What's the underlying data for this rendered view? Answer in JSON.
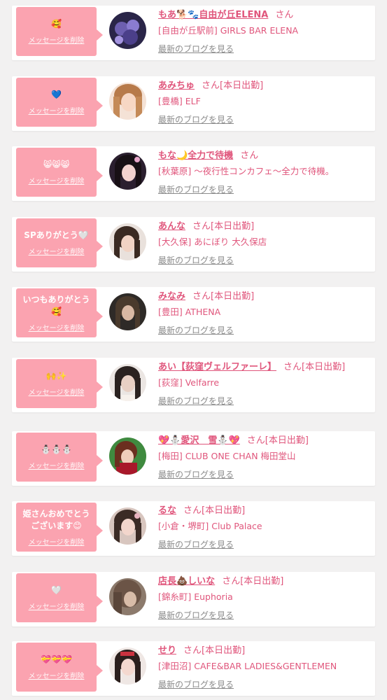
{
  "delete_label": "メッセージを削除",
  "blog_label": "最新のブログを見る",
  "items": [
    {
      "message": "🥰",
      "name": "もあ🐕🐾自由が丘ELENA",
      "suffix": "さん",
      "shop": "[自由が丘駅前] GIRLS BAR ELENA"
    },
    {
      "message": "💙",
      "name": "あみちゅ",
      "suffix": "さん[本日出勤]",
      "shop": "[豊橋] ELF"
    },
    {
      "message": "😸😸😸",
      "name": "もな🌙全力で待機",
      "suffix": "さん",
      "shop": "[秋葉原] 〜夜行性コンカフェ〜全力で待機。"
    },
    {
      "message": "SPありがとう🤍",
      "name": "あんな",
      "suffix": "さん[本日出勤]",
      "shop": "[大久保] あにぼり 大久保店"
    },
    {
      "message": "いつもありがとう\n🥰",
      "name": "みなみ",
      "suffix": "さん[本日出勤]",
      "shop": "[豊田] ATHENA"
    },
    {
      "message": "🙌✨",
      "name": "あい【荻窪ヴェルファーレ】",
      "suffix": "さん[本日出勤]",
      "shop": "[荻窪] Velfarre"
    },
    {
      "message": "⛄⛄⛄",
      "name": "💖⛄愛沢　雪⛄💖",
      "suffix": "さん[本日出勤]",
      "shop": "[梅田] CLUB ONE CHAN 梅田堂山"
    },
    {
      "message": "姫さんおめでとう\nございます😊",
      "name": "るな",
      "suffix": "さん[本日出勤]",
      "shop": "[小倉・堺町] Club Palace"
    },
    {
      "message": "🤍",
      "name": "店長💩しいな",
      "suffix": "さん[本日出勤]",
      "shop": "[錦糸町] Euphoria"
    },
    {
      "message": "💝💝💝",
      "name": "せり",
      "suffix": "さん[本日出勤]",
      "shop": "[津田沼] CAFE&BAR LADIES&GENTLEMEN"
    }
  ],
  "colors": {
    "accent": "#e0567c",
    "bubble": "#fba3b0",
    "link_gray": "#8b8b8b",
    "background": "#f2f1f1"
  }
}
